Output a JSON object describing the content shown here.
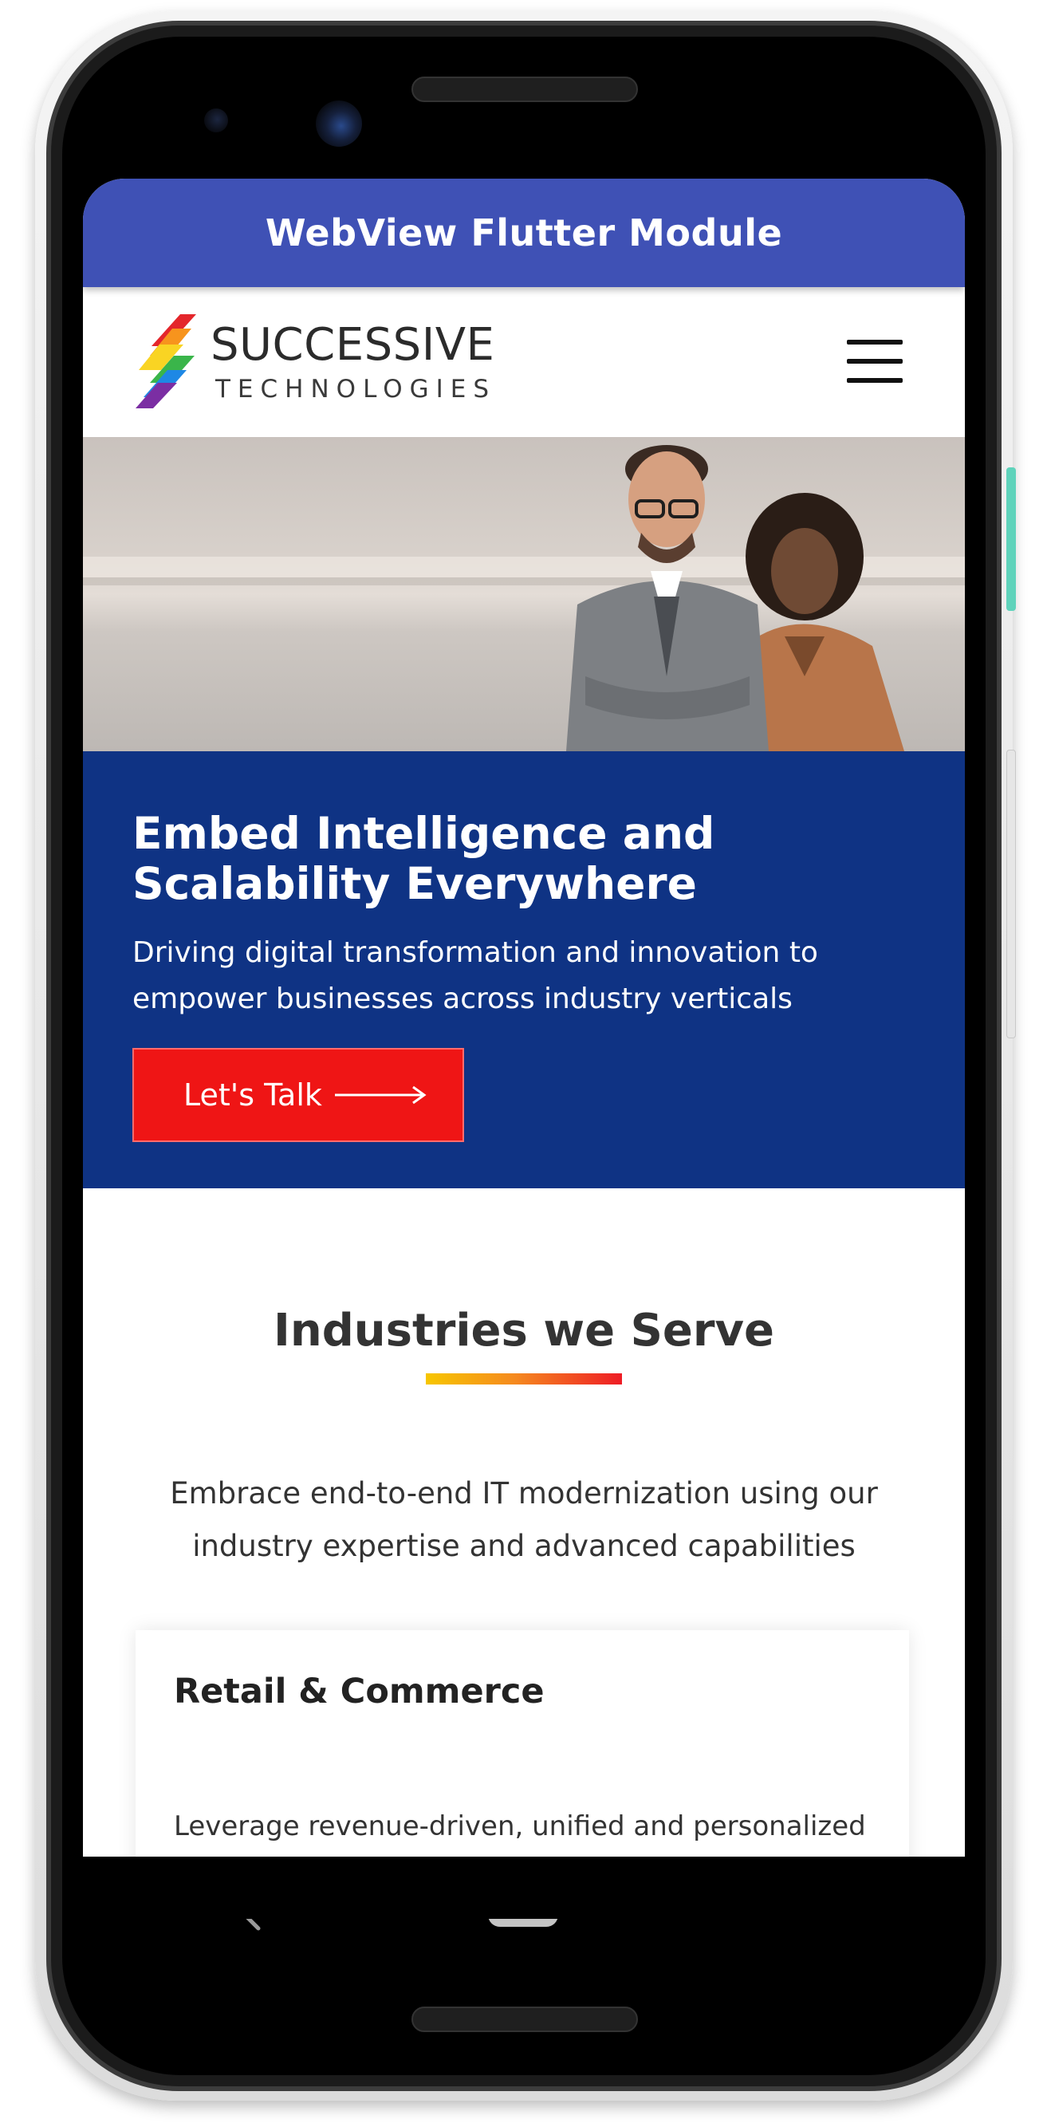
{
  "app_bar": {
    "title": "WebView Flutter Module"
  },
  "site_header": {
    "logo_line1": "SUCCESSIVE",
    "logo_line2": "TECHNOLOGIES",
    "menu_icon": "hamburger-menu-icon"
  },
  "hero": {
    "title": "Embed Intelligence and Scalability Everywhere",
    "subtitle": "Driving digital transformation and innovation to empower businesses across industry verticals",
    "cta_label": "Let's Talk",
    "cta_icon": "arrow-right-icon"
  },
  "industries": {
    "title": "Industries we Serve",
    "description": "Embrace end-to-end IT modernization using our industry expertise and advanced capabilities",
    "cards": [
      {
        "title": "Retail & Commerce",
        "text": "Leverage revenue-driven, unified and personalized"
      }
    ]
  },
  "nav_bar": {
    "back_icon": "back-chevron-icon",
    "home_icon": "home-pill-icon"
  },
  "colors": {
    "app_bar": "#3f51b5",
    "hero_banner": "#0f3384",
    "cta": "#ef1515",
    "underline_start": "#f7c600",
    "underline_end": "#ee1c25"
  }
}
